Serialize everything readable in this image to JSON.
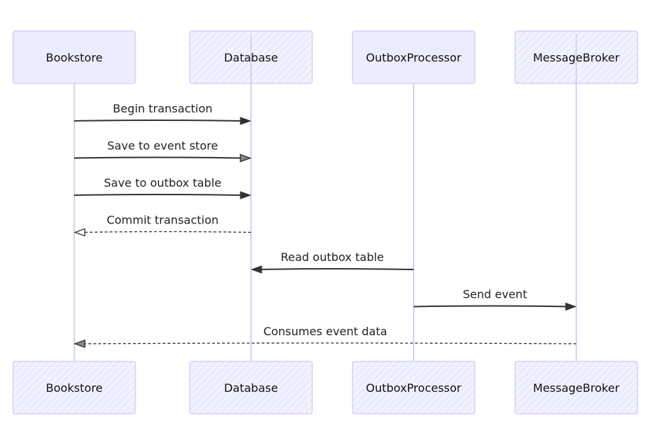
{
  "diagram": {
    "type": "sequence",
    "colors": {
      "actor_fill": "#ECECFF",
      "actor_border": "#D7CFF5",
      "lifeline": "#D8CFF3",
      "hatch": "#FFFFFF",
      "arrow": "#333333",
      "text": "#111111"
    },
    "actors": [
      {
        "id": "bookstore",
        "label": "Bookstore",
        "style": "solid"
      },
      {
        "id": "database",
        "label": "Database",
        "style": "hatched"
      },
      {
        "id": "outbox",
        "label": "OutboxProcessor",
        "style": "solid"
      },
      {
        "id": "broker",
        "label": "MessageBroker",
        "style": "hatched"
      }
    ],
    "messages": [
      {
        "from": "bookstore",
        "to": "database",
        "label": "Begin transaction",
        "line": "solid",
        "head": "filled"
      },
      {
        "from": "bookstore",
        "to": "database",
        "label": "Save to event store",
        "line": "solid",
        "head": "hatched"
      },
      {
        "from": "bookstore",
        "to": "database",
        "label": "Save to outbox table",
        "line": "solid",
        "head": "filled"
      },
      {
        "from": "database",
        "to": "bookstore",
        "label": "Commit transaction",
        "line": "dashed",
        "head": "open"
      },
      {
        "from": "outbox",
        "to": "database",
        "label": "Read outbox table",
        "line": "solid",
        "head": "filled"
      },
      {
        "from": "outbox",
        "to": "broker",
        "label": "Send event",
        "line": "solid",
        "head": "filled"
      },
      {
        "from": "broker",
        "to": "bookstore",
        "label": "Consumes event data",
        "line": "dashed",
        "head": "hatched"
      }
    ]
  }
}
